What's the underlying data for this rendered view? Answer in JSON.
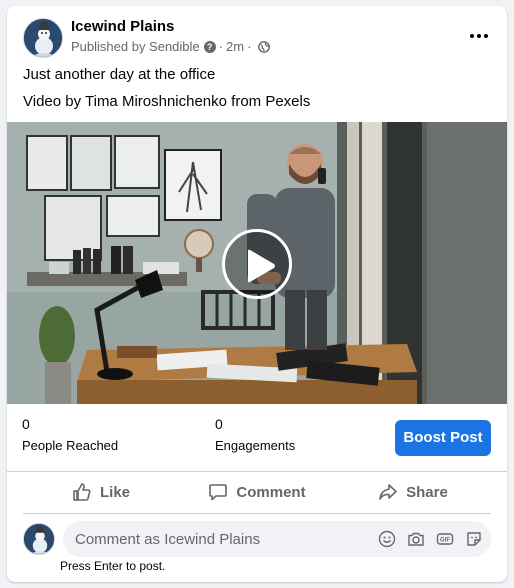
{
  "post": {
    "page_name": "Icewind Plains",
    "published_by": "Published by Sendible",
    "time": "2m",
    "caption": "Just another day at the office",
    "credit": "Video by Tima Miroshnichenko from Pexels"
  },
  "stats": {
    "reached_value": "0",
    "reached_label": "People Reached",
    "engagements_value": "0",
    "engagements_label": "Engagements",
    "boost_label": "Boost Post"
  },
  "actions": {
    "like": "Like",
    "comment": "Comment",
    "share": "Share"
  },
  "composer": {
    "placeholder": "Comment as Icewind Plains",
    "hint": "Press Enter to post."
  },
  "colors": {
    "accent": "#1b74e4",
    "muted": "#65676b"
  }
}
